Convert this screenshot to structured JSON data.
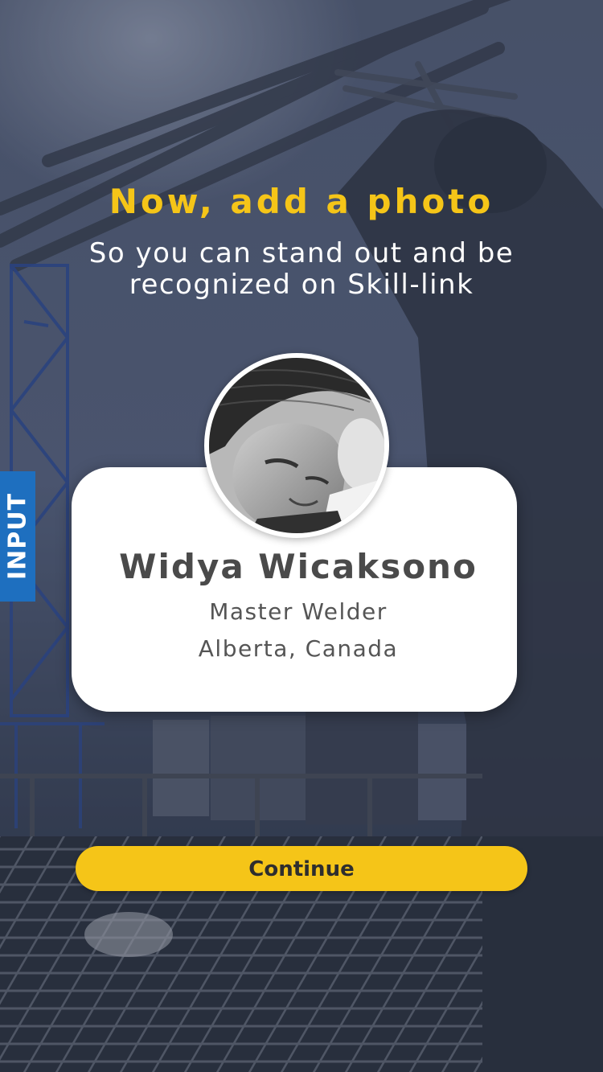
{
  "colors": {
    "accent": "#f5c518",
    "tab_blue": "#1e6fbf",
    "card_bg": "#ffffff",
    "text_dark": "#4a4a4a"
  },
  "header": {
    "title": "Now, add a photo",
    "subtitle": "So you can stand out and be recognized on Skill-link"
  },
  "side_tab": {
    "label": "INPUT"
  },
  "profile": {
    "avatar_icon": "profile-photo",
    "name": "Widya Wicaksono",
    "role": "Master Welder",
    "location": "Alberta, Canada"
  },
  "actions": {
    "continue_label": "Continue"
  }
}
